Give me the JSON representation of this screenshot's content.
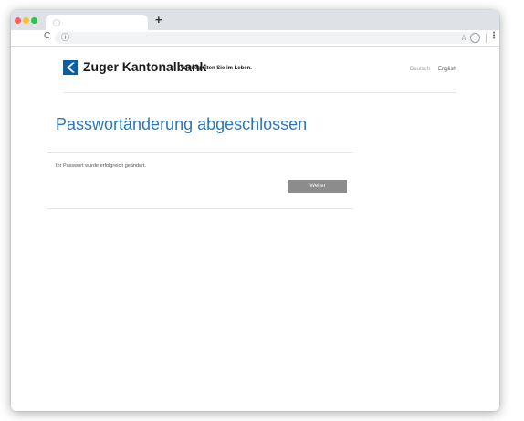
{
  "browser": {
    "new_tab_label": "+",
    "info_icon": "ⓘ",
    "star_icon": "☆",
    "reload_icon": "C",
    "menu_icon": "⋮"
  },
  "header": {
    "bank_name": "Zuger Kantonalbank",
    "slogan": "Wir begleiten Sie im Leben.",
    "languages": [
      "Deutsch",
      "English"
    ],
    "brand_color": "#0a5ea8"
  },
  "main": {
    "title": "Passwortänderung abgeschlossen",
    "message": "Ihr Passwort wurde erfolgreich geändert.",
    "continue_label": "Weiter",
    "title_color": "#2e78b7",
    "button_color": "#8c8c8c"
  }
}
